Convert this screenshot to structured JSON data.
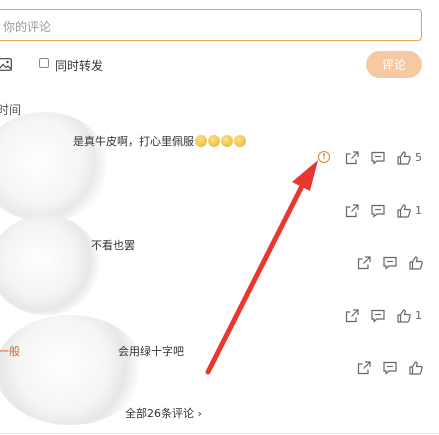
{
  "comment_input": {
    "placeholder": "你的评论"
  },
  "forward_checkbox": {
    "label": "同时转发",
    "checked": false
  },
  "submit": {
    "label": "评论"
  },
  "sort": {
    "label": "时间"
  },
  "comments": [
    {
      "text": "是真牛皮啊，打心里佩服",
      "emoji_count": 4,
      "likes": "5",
      "has_report": true
    },
    {
      "text": "",
      "likes": "1"
    },
    {
      "text": "不看也罢",
      "likes": ""
    },
    {
      "text": "",
      "likes": "1"
    },
    {
      "reply_name": "一般",
      "text": "会用绿十字吧",
      "likes": ""
    }
  ],
  "view_all": {
    "label": "全部26条评论 ›"
  },
  "colors": {
    "accent": "#e4862f",
    "button": "#f6c9a2",
    "arrow": "#e8372c"
  }
}
